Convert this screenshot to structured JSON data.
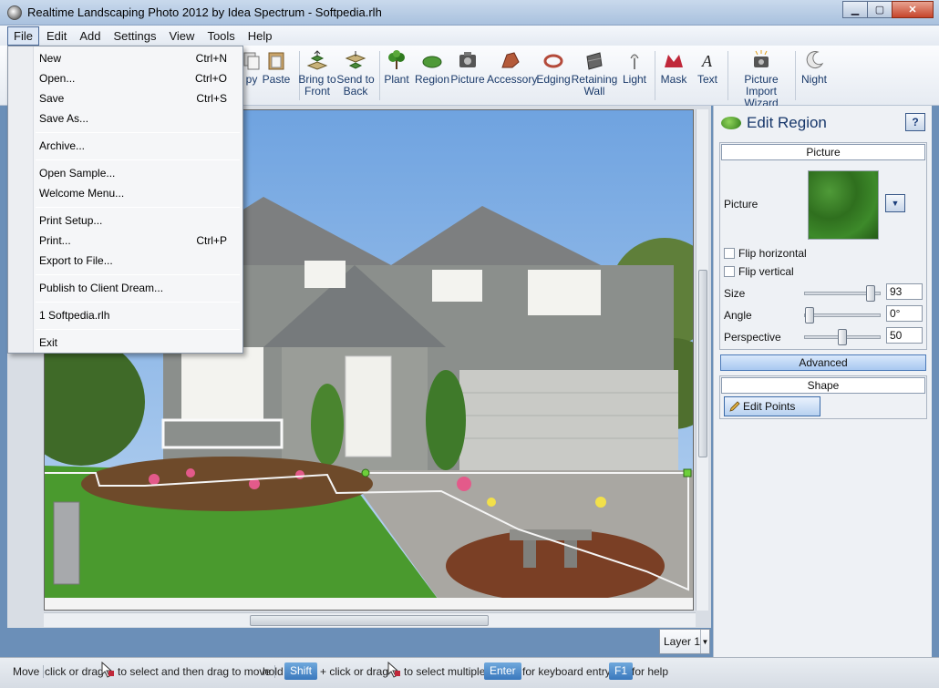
{
  "window": {
    "title": "Realtime Landscaping Photo 2012 by Idea Spectrum - Softpedia.rlh",
    "minimize": "0",
    "maximize": "1",
    "close": "r"
  },
  "menubar": [
    "File",
    "Edit",
    "Add",
    "Settings",
    "View",
    "Tools",
    "Help"
  ],
  "toolbar": {
    "tools": [
      {
        "label": "py",
        "icon": "copy-icon"
      },
      {
        "label": "Paste",
        "icon": "paste-icon"
      },
      {
        "label": "Bring to Front",
        "icon": "bring-to-front-icon"
      },
      {
        "label": "Send to Back",
        "icon": "send-to-back-icon"
      },
      {
        "label": "Plant",
        "icon": "plant-icon"
      },
      {
        "label": "Region",
        "icon": "region-icon"
      },
      {
        "label": "Picture",
        "icon": "picture-icon"
      },
      {
        "label": "Accessory",
        "icon": "accessory-icon"
      },
      {
        "label": "Edging",
        "icon": "edging-icon"
      },
      {
        "label": "Retaining Wall",
        "icon": "retaining-wall-icon"
      },
      {
        "label": "Light",
        "icon": "light-icon"
      },
      {
        "label": "Mask",
        "icon": "mask-icon"
      },
      {
        "label": "Text",
        "icon": "text-icon"
      },
      {
        "label": "Picture Import Wizard",
        "icon": "picture-import-wizard-icon"
      },
      {
        "label": "Night",
        "icon": "night-icon"
      }
    ]
  },
  "file_menu": {
    "items": [
      {
        "label": "New",
        "shortcut": "Ctrl+N"
      },
      {
        "label": "Open...",
        "shortcut": "Ctrl+O"
      },
      {
        "label": "Save",
        "shortcut": "Ctrl+S"
      },
      {
        "label": "Save As...",
        "shortcut": ""
      },
      {
        "label": "Archive...",
        "shortcut": ""
      },
      {
        "label": "Open Sample...",
        "shortcut": ""
      },
      {
        "label": "Welcome Menu...",
        "shortcut": ""
      },
      {
        "label": "Print Setup...",
        "shortcut": ""
      },
      {
        "label": "Print...",
        "shortcut": "Ctrl+P"
      },
      {
        "label": "Export to File...",
        "shortcut": ""
      },
      {
        "label": "Publish to Client Dream...",
        "shortcut": ""
      },
      {
        "label": "1 Softpedia.rlh",
        "shortcut": ""
      },
      {
        "label": "Exit",
        "shortcut": ""
      }
    ]
  },
  "panel": {
    "title": "Edit Region",
    "help": "?",
    "picture_group": "Picture",
    "picture_label": "Picture",
    "flip_horizontal": "Flip horizontal",
    "flip_vertical": "Flip vertical",
    "size_label": "Size",
    "size_value": "93",
    "size_level": 0.93,
    "angle_label": "Angle",
    "angle_value": "0°",
    "angle_level": 0.0,
    "perspective_label": "Perspective",
    "perspective_value": "50",
    "perspective_level": 0.5,
    "advanced": "Advanced",
    "shape_group": "Shape",
    "edit_points": "Edit Points"
  },
  "layer_select": "Layer 1",
  "statusbar": {
    "mode": "Move",
    "t1": "click or drag",
    "t2": "to select and then drag to move",
    "t3": "hold",
    "key_shift": "Shift",
    "t4": "+ click or drag",
    "t5": "to select multiple",
    "key_enter": "Enter",
    "t6": "for keyboard entry",
    "key_f1": "F1",
    "t7": "for help"
  },
  "colors": {
    "accent": "#3a78bd",
    "title_text": "#17376a"
  }
}
